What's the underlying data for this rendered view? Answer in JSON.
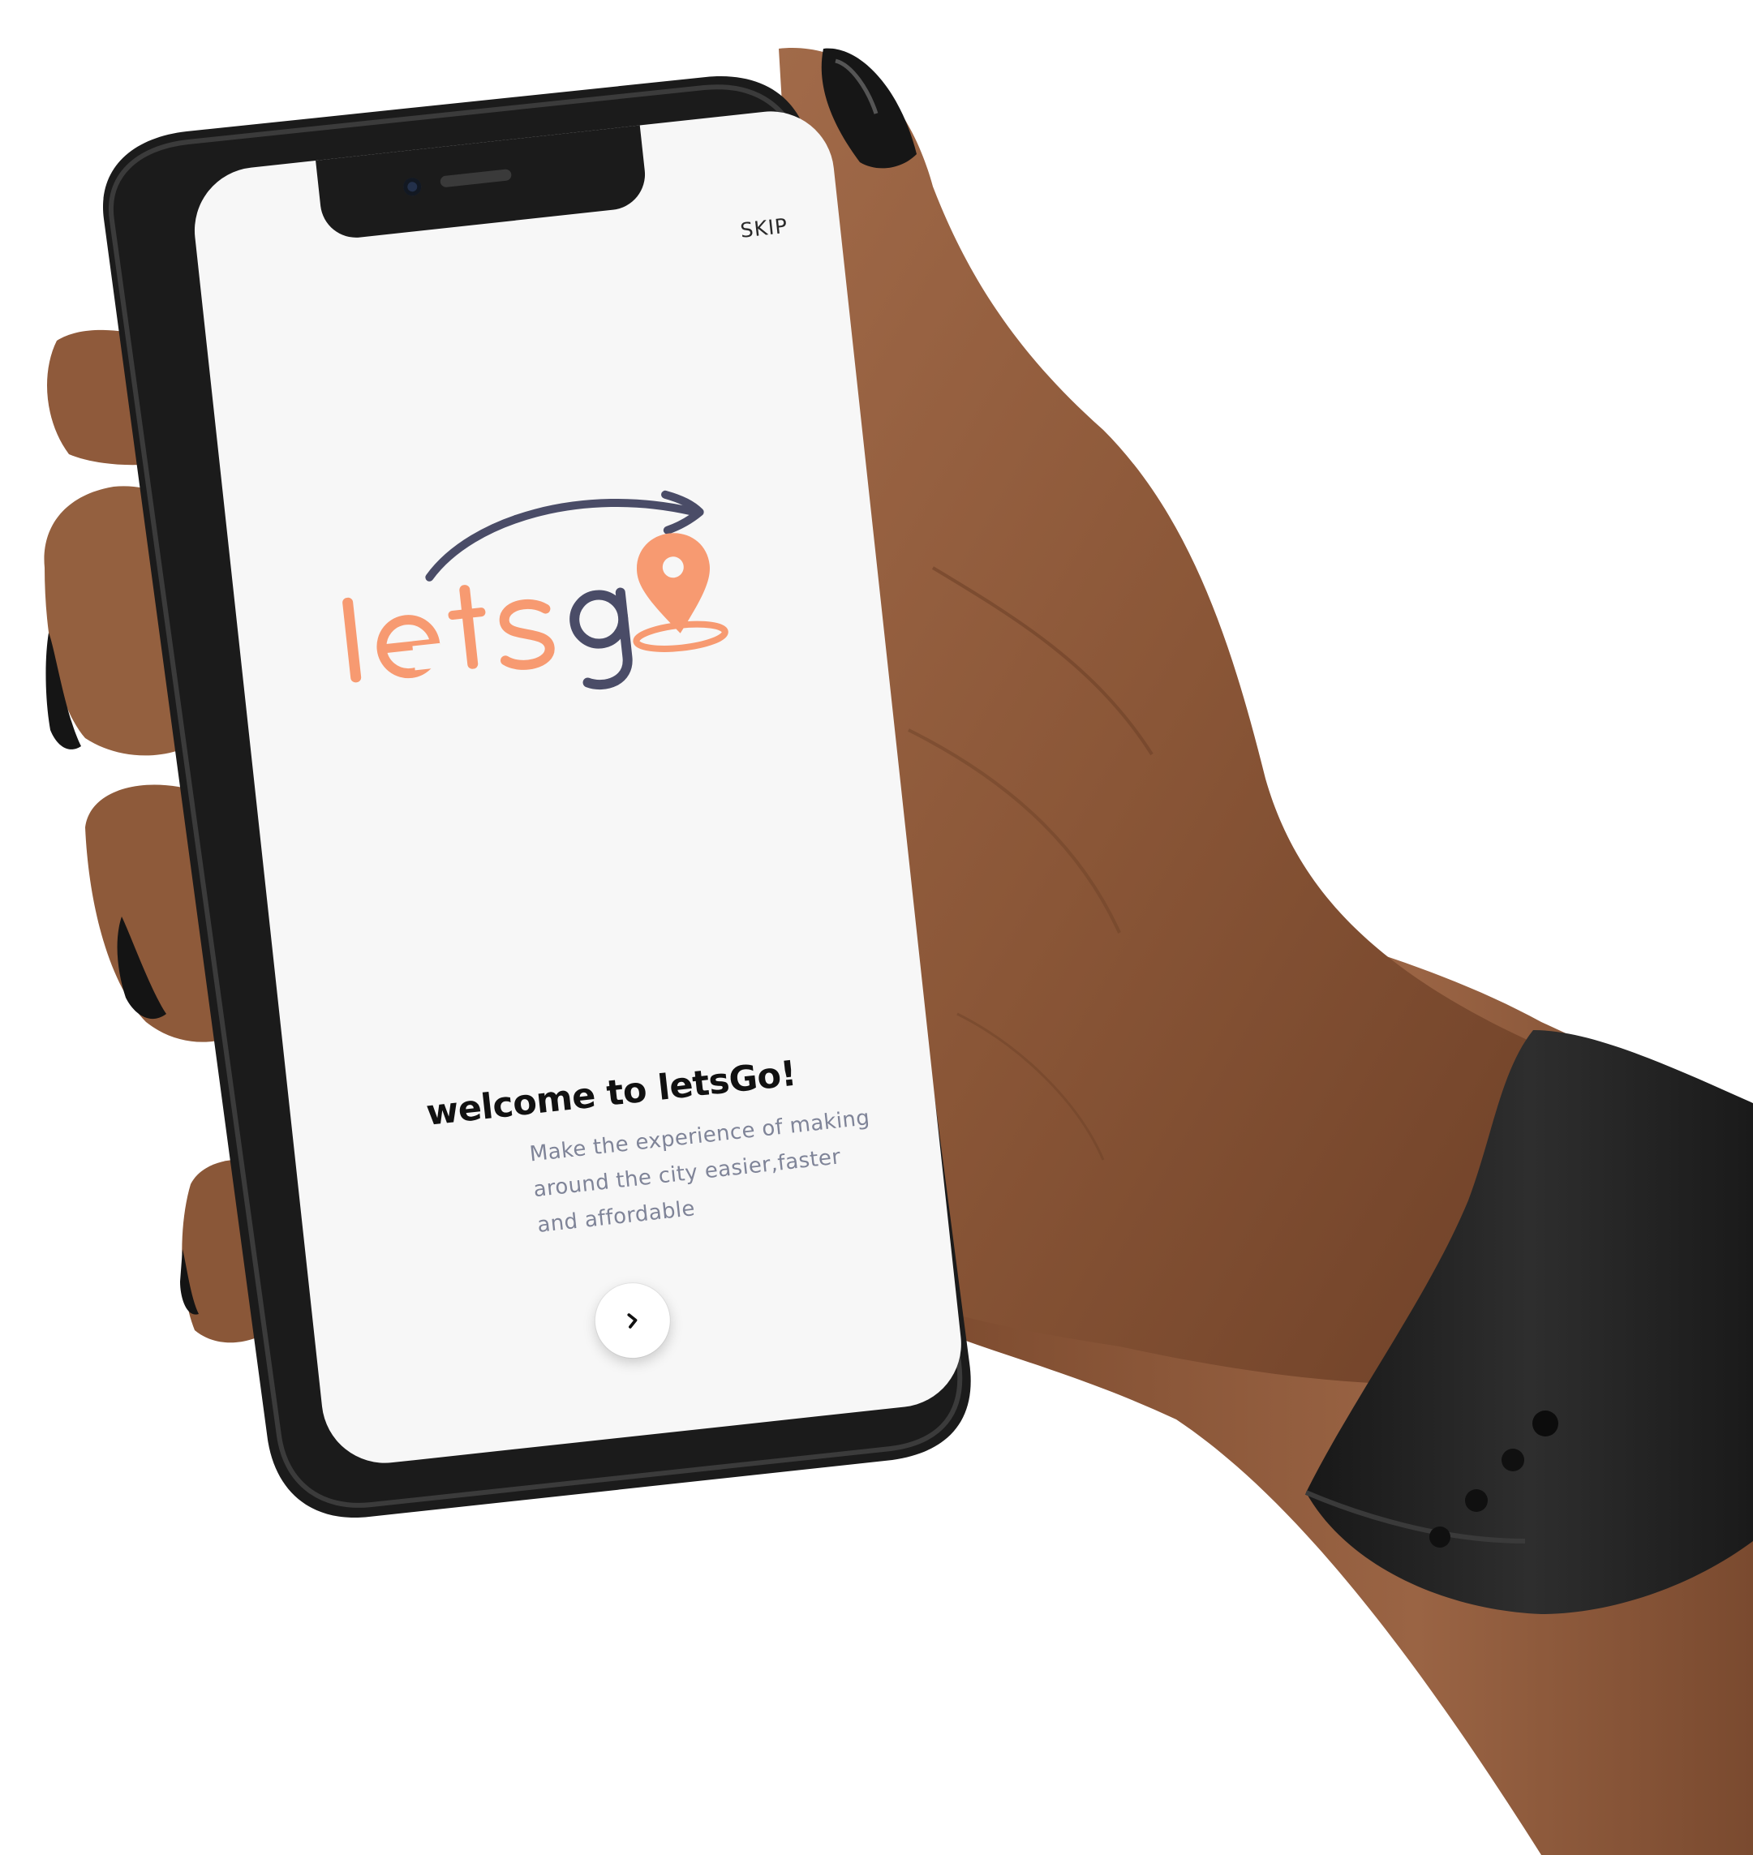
{
  "screen": {
    "skip_label": "SKIP",
    "logo": {
      "text": "letsgo",
      "orange": "#f79a71",
      "navy": "#4a4c67"
    },
    "welcome_title": "welcome to letsGo!",
    "description": "Make the experience of making around the city easier,faster and affordable",
    "next_icon": "chevron-right-icon"
  },
  "colors": {
    "screen_bg": "#f7f7f7",
    "phone_body": "#1b1b1b",
    "skin": "#8b5a3c",
    "watch_band": "#232323",
    "nail": "#1a1a1a"
  }
}
